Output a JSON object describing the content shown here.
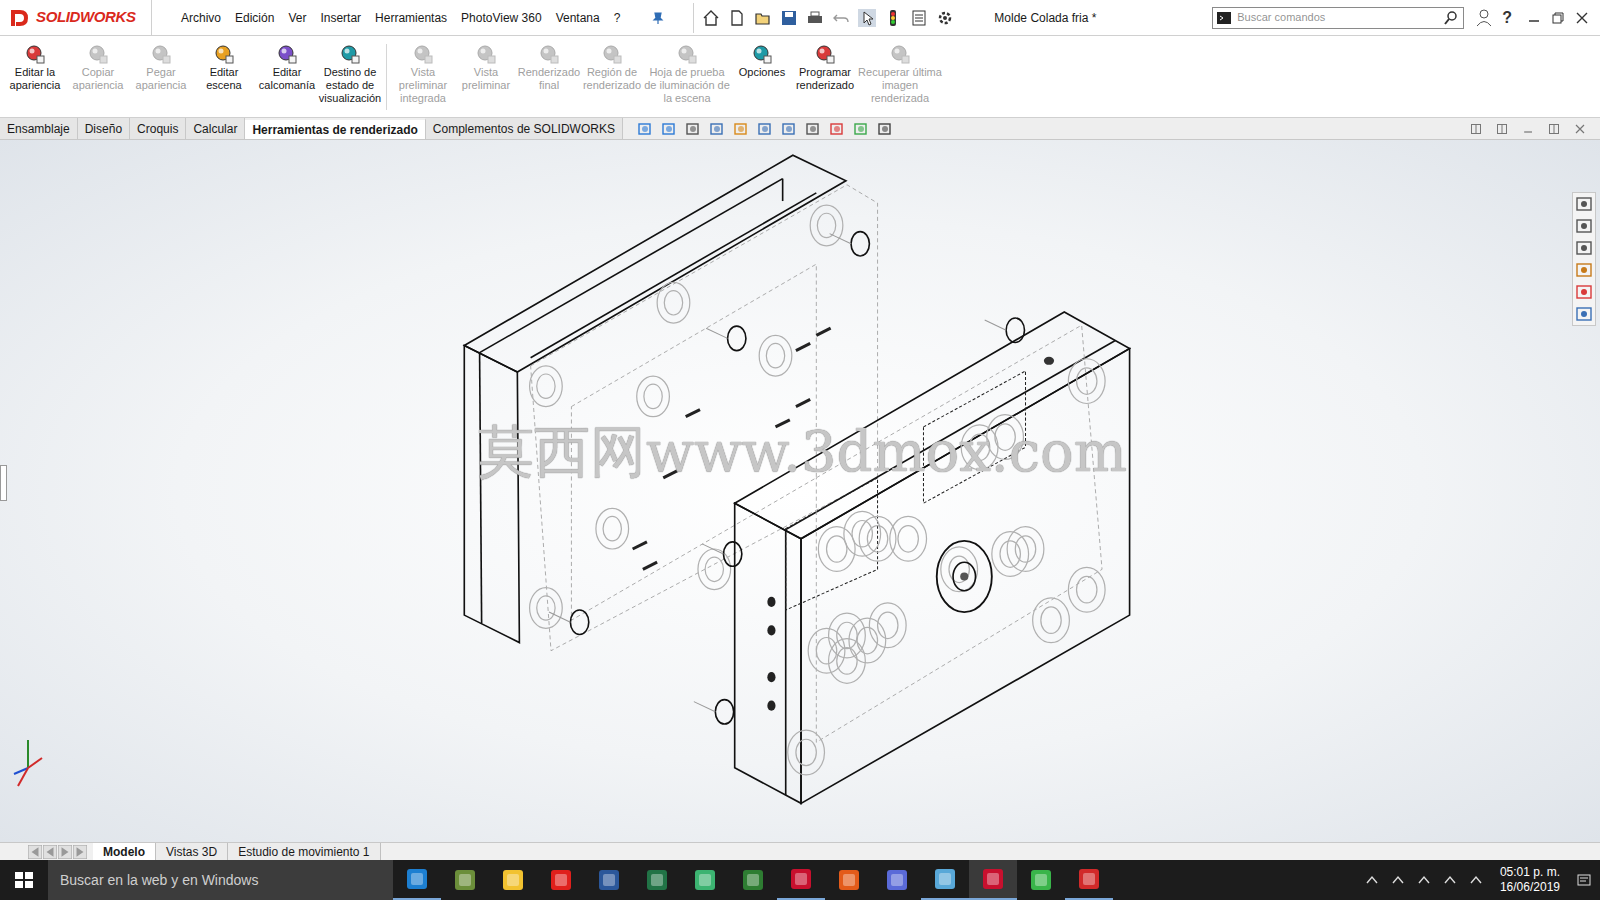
{
  "app": {
    "logo": "SOLIDWORKS",
    "document_title": "Molde Colada fria *",
    "help": "?"
  },
  "menu": [
    "Archivo",
    "Edición",
    "Ver",
    "Insertar",
    "Herramientas",
    "PhotoView 360",
    "Ventana",
    "?"
  ],
  "search": {
    "placeholder": "Buscar comandos"
  },
  "ribbon": [
    {
      "label": "Editar la apariencia",
      "disabled": false
    },
    {
      "label": "Copiar apariencia",
      "disabled": true
    },
    {
      "label": "Pegar apariencia",
      "disabled": true
    },
    {
      "label": "Editar escena",
      "disabled": false
    },
    {
      "label": "Editar calcomanía",
      "disabled": false
    },
    {
      "label": "Destino de estado de visualización",
      "disabled": false
    },
    {
      "label": "Vista preliminar integrada",
      "disabled": true
    },
    {
      "label": "Vista preliminar",
      "disabled": true
    },
    {
      "label": "Renderizado final",
      "disabled": true
    },
    {
      "label": "Región de renderizado",
      "disabled": true
    },
    {
      "label": "Hoja de prueba de iluminación de la escena",
      "disabled": true
    },
    {
      "label": "Opciones",
      "disabled": false
    },
    {
      "label": "Programar renderizado",
      "disabled": false
    },
    {
      "label": "Recuperar última imagen renderizada",
      "disabled": true
    }
  ],
  "tabs": [
    {
      "label": "Ensamblaje",
      "selected": false
    },
    {
      "label": "Diseño",
      "selected": false
    },
    {
      "label": "Croquis",
      "selected": false
    },
    {
      "label": "Calcular",
      "selected": false
    },
    {
      "label": "Herramientas de renderizado",
      "selected": true
    },
    {
      "label": "Complementos de SOLIDWORKS",
      "selected": false
    }
  ],
  "viewport": {
    "watermark": "莫西网www.3dmox.com"
  },
  "bottom_tabs": [
    {
      "label": "Modelo",
      "selected": true
    },
    {
      "label": "Vistas 3D",
      "selected": false
    },
    {
      "label": "Estudio de movimiento 1",
      "selected": false
    }
  ],
  "taskbar": {
    "search_placeholder": "Buscar en la web y en Windows",
    "time": "05:01 p. m.",
    "date": "16/06/2019"
  }
}
